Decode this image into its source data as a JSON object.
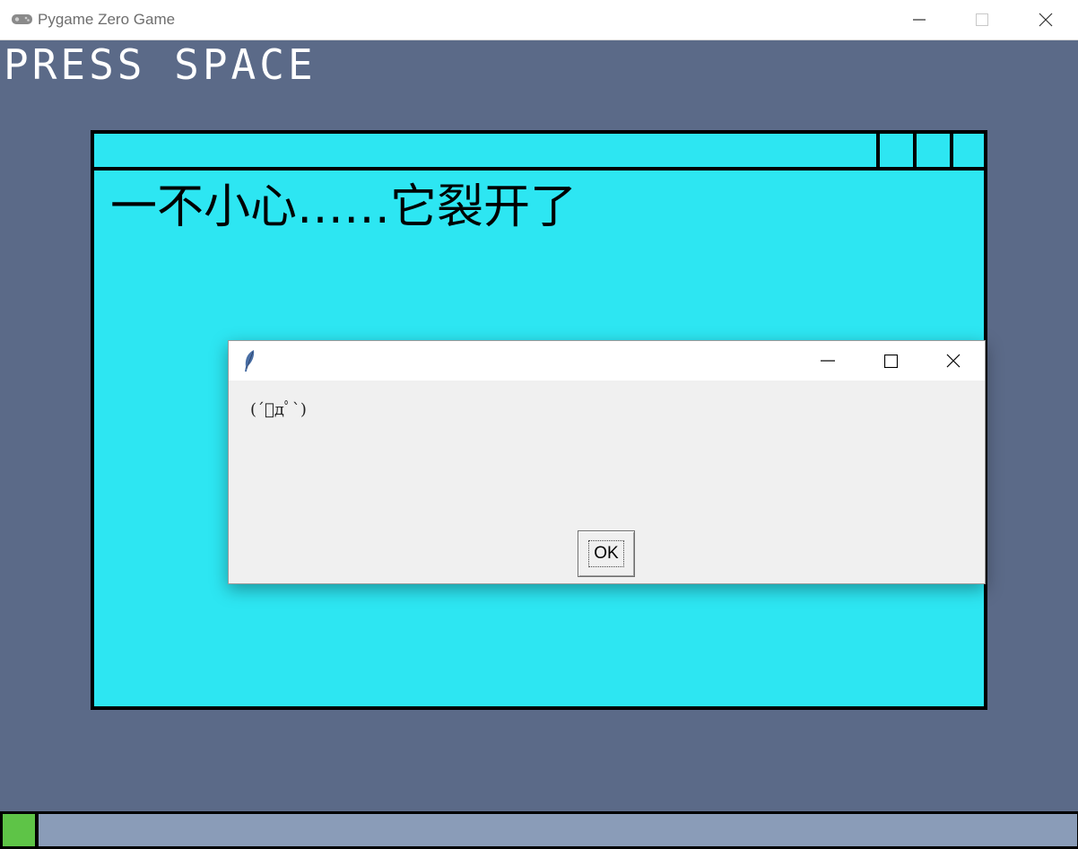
{
  "window": {
    "title": "Pygame Zero Game",
    "controls": [
      "minimize",
      "maximize",
      "close"
    ]
  },
  "game": {
    "prompt": "PRESS SPACE",
    "window_text": "一不小心……它裂开了",
    "window_bg": "#2de6f2",
    "canvas_bg": "#5b6a88"
  },
  "dialog": {
    "message": "(´ﾟдﾟ`)",
    "ok_label": "OK",
    "icon": "tk-feather-icon"
  },
  "progress": {
    "value_fraction": 0.03,
    "fill_color": "#5ec447",
    "track_color": "#8a9cb8"
  }
}
